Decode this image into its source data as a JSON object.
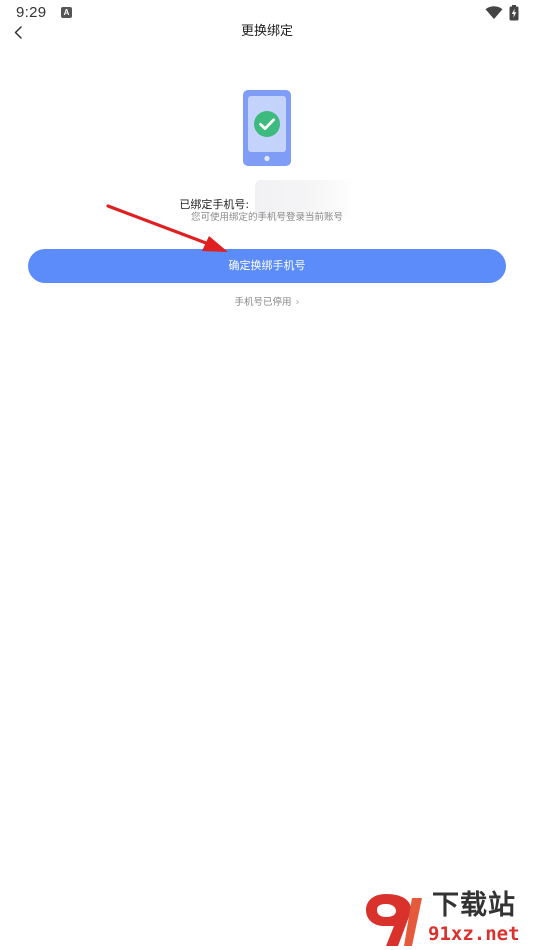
{
  "status_bar": {
    "time": "9:29",
    "notification_glyph": "A",
    "icons": [
      "wifi-icon",
      "battery-charging-icon"
    ]
  },
  "nav": {
    "title": "更换绑定",
    "back_icon": "chevron-left-icon"
  },
  "binding": {
    "illustration_icon": "phone-check-icon",
    "bound_label": "已绑定手机号:",
    "hint": "您可使用绑定的手机号登录当前账号",
    "confirm_button": "确定换绑手机号",
    "disabled_link": "手机号已停用",
    "disabled_link_icon": "chevron-right-icon"
  },
  "watermark": {
    "title": "下载站",
    "site": "91xz.net"
  },
  "colors": {
    "accent": "#5b8cf9",
    "phone_body": "#7f9df5",
    "check_green": "#3dbb7e",
    "annotation_red": "#e02020",
    "hint_gray": "#8a8a8a"
  }
}
